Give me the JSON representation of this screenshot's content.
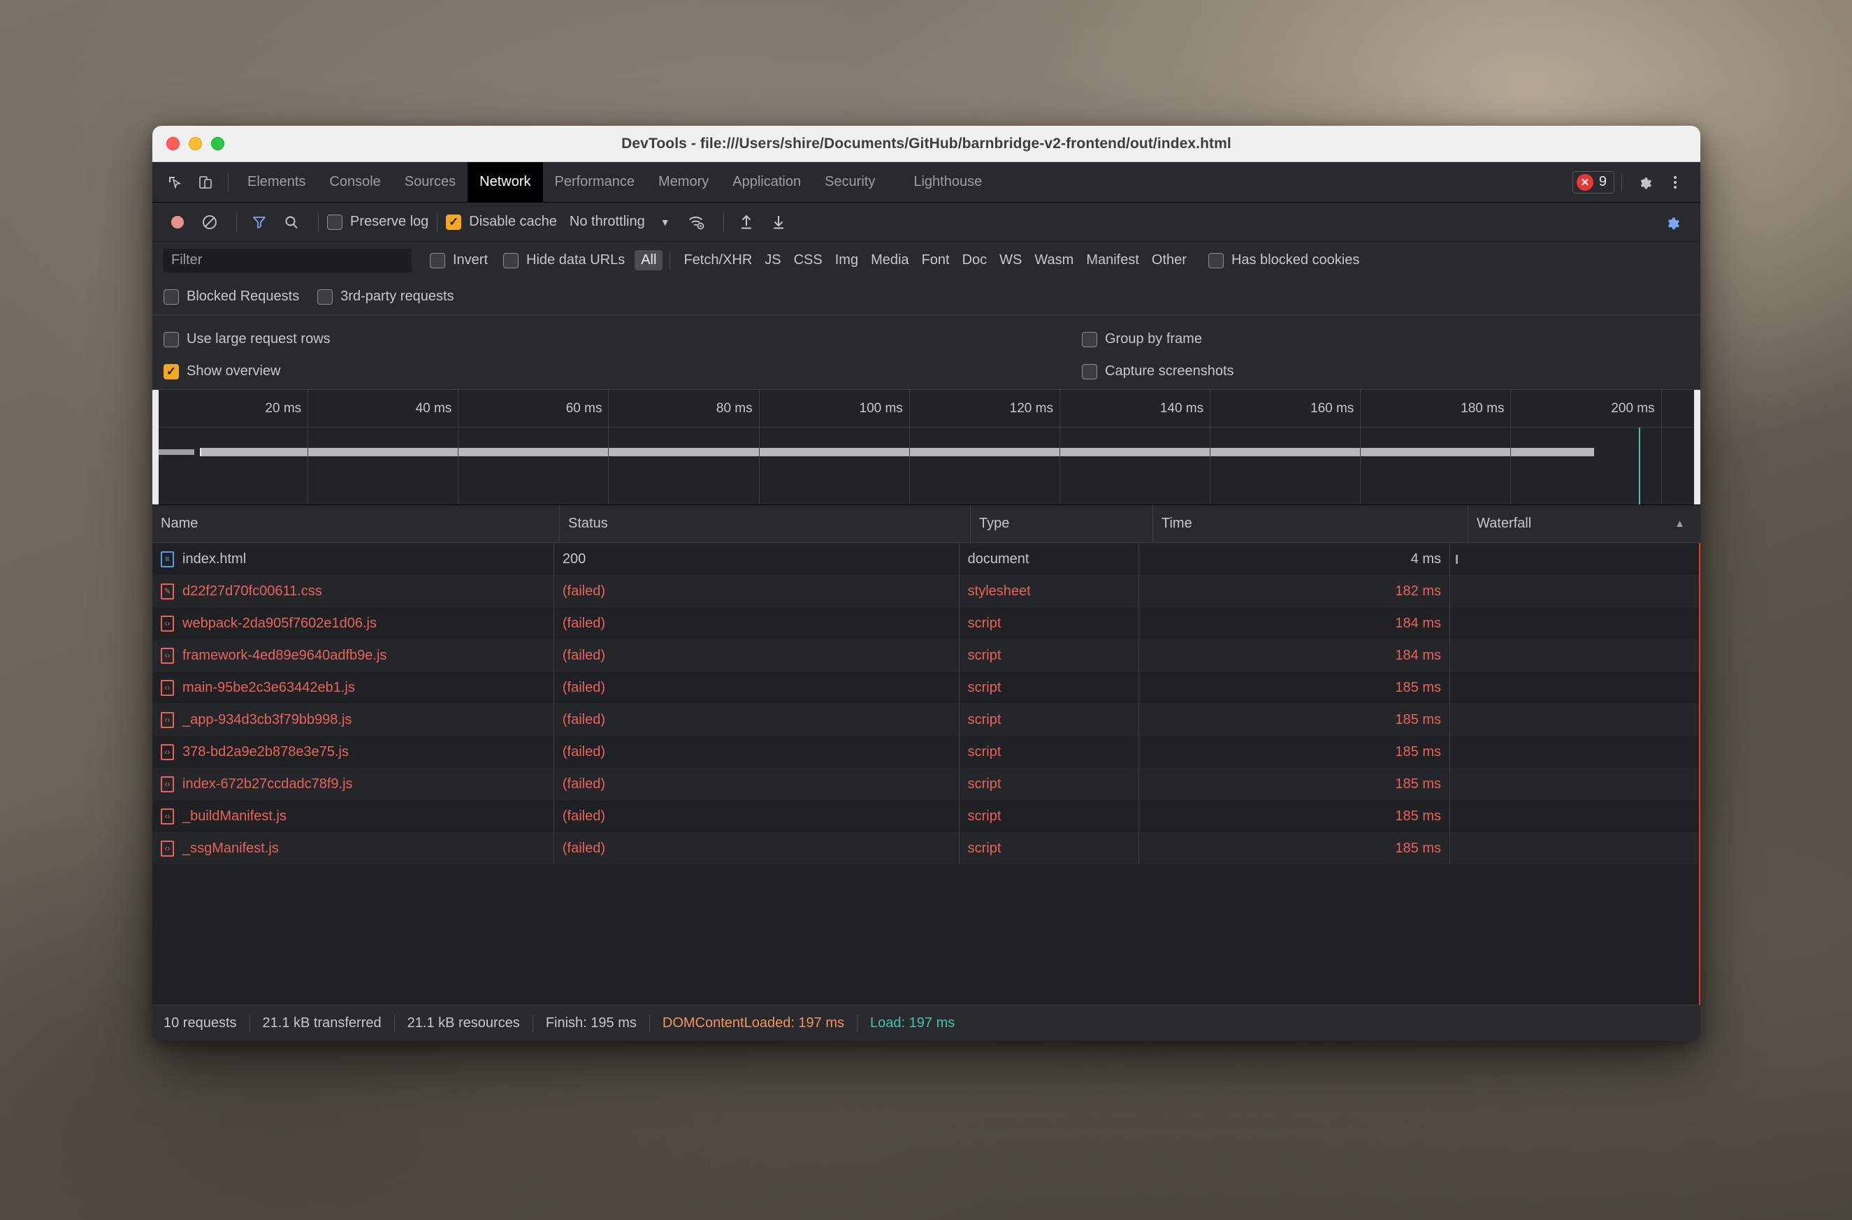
{
  "window": {
    "title": "DevTools - file:///Users/shire/Documents/GitHub/barnbridge-v2-frontend/out/index.html"
  },
  "tabbar": {
    "tabs": [
      {
        "label": "Elements",
        "active": false
      },
      {
        "label": "Console",
        "active": false
      },
      {
        "label": "Sources",
        "active": false
      },
      {
        "label": "Network",
        "active": true
      },
      {
        "label": "Performance",
        "active": false
      },
      {
        "label": "Memory",
        "active": false
      },
      {
        "label": "Application",
        "active": false
      },
      {
        "label": "Security",
        "active": false
      },
      {
        "label": "Lighthouse",
        "active": false
      }
    ],
    "error_count": "9",
    "icons": [
      "inspect-element-icon",
      "device-toolbar-icon",
      "error-icon",
      "settings-gear-icon",
      "more-options-icon"
    ]
  },
  "network_toolbar": {
    "record_label": "record-button",
    "clear_label": "clear-button",
    "filter_label": "filter-button",
    "search_label": "search-button",
    "preserve_log": {
      "label": "Preserve log",
      "checked": false
    },
    "disable_cache": {
      "label": "Disable cache",
      "checked": true
    },
    "throttling": {
      "value": "No throttling"
    },
    "import_label": "import-har-button",
    "export_label": "export-har-button",
    "network_conditions_label": "network-conditions-icon",
    "settings_label": "network-settings-icon"
  },
  "filterbar": {
    "filter_placeholder": "Filter",
    "filter_value": "",
    "invert": {
      "label": "Invert",
      "checked": false
    },
    "hide_data_urls": {
      "label": "Hide data URLs",
      "checked": false
    },
    "types": [
      {
        "label": "All",
        "active": true
      },
      {
        "label": "Fetch/XHR",
        "active": false
      },
      {
        "label": "JS",
        "active": false
      },
      {
        "label": "CSS",
        "active": false
      },
      {
        "label": "Img",
        "active": false
      },
      {
        "label": "Media",
        "active": false
      },
      {
        "label": "Font",
        "active": false
      },
      {
        "label": "Doc",
        "active": false
      },
      {
        "label": "WS",
        "active": false
      },
      {
        "label": "Wasm",
        "active": false
      },
      {
        "label": "Manifest",
        "active": false
      },
      {
        "label": "Other",
        "active": false
      }
    ],
    "has_blocked_cookies": {
      "label": "Has blocked cookies",
      "checked": false
    },
    "blocked_requests": {
      "label": "Blocked Requests",
      "checked": false
    },
    "third_party_requests": {
      "label": "3rd-party requests",
      "checked": false
    }
  },
  "settings": {
    "use_large_request_rows": {
      "label": "Use large request rows",
      "checked": false
    },
    "show_overview": {
      "label": "Show overview",
      "checked": true
    },
    "group_by_frame": {
      "label": "Group by frame",
      "checked": false
    },
    "capture_screenshots": {
      "label": "Capture screenshots",
      "checked": false
    }
  },
  "overview": {
    "ticks": [
      "20 ms",
      "40 ms",
      "60 ms",
      "80 ms",
      "100 ms",
      "120 ms",
      "140 ms",
      "160 ms",
      "180 ms",
      "200 ms"
    ],
    "load_marker_color": "#49c3b1",
    "load_marker_ms": 197
  },
  "table": {
    "columns": [
      "Name",
      "Status",
      "Type",
      "Time",
      "Waterfall"
    ],
    "sort_column": "Waterfall",
    "sort_direction": "ascending",
    "rows": [
      {
        "name": "index.html",
        "status": "200",
        "type": "document",
        "time": "4 ms",
        "failed": false,
        "icon": "document-icon"
      },
      {
        "name": "d22f27d70fc00611.css",
        "status": "(failed)",
        "type": "stylesheet",
        "time": "182 ms",
        "failed": true,
        "icon": "stylesheet-icon"
      },
      {
        "name": "webpack-2da905f7602e1d06.js",
        "status": "(failed)",
        "type": "script",
        "time": "184 ms",
        "failed": true,
        "icon": "script-icon"
      },
      {
        "name": "framework-4ed89e9640adfb9e.js",
        "status": "(failed)",
        "type": "script",
        "time": "184 ms",
        "failed": true,
        "icon": "script-icon"
      },
      {
        "name": "main-95be2c3e63442eb1.js",
        "status": "(failed)",
        "type": "script",
        "time": "185 ms",
        "failed": true,
        "icon": "script-icon"
      },
      {
        "name": "_app-934d3cb3f79bb998.js",
        "status": "(failed)",
        "type": "script",
        "time": "185 ms",
        "failed": true,
        "icon": "script-icon"
      },
      {
        "name": "378-bd2a9e2b878e3e75.js",
        "status": "(failed)",
        "type": "script",
        "time": "185 ms",
        "failed": true,
        "icon": "script-icon"
      },
      {
        "name": "index-672b27ccdadc78f9.js",
        "status": "(failed)",
        "type": "script",
        "time": "185 ms",
        "failed": true,
        "icon": "script-icon"
      },
      {
        "name": "_buildManifest.js",
        "status": "(failed)",
        "type": "script",
        "time": "185 ms",
        "failed": true,
        "icon": "script-icon"
      },
      {
        "name": "_ssgManifest.js",
        "status": "(failed)",
        "type": "script",
        "time": "185 ms",
        "failed": true,
        "icon": "script-icon"
      }
    ]
  },
  "statusbar": {
    "requests": "10 requests",
    "transferred": "21.1 kB transferred",
    "resources": "21.1 kB resources",
    "finish": "Finish: 195 ms",
    "dom_content_loaded": "DOMContentLoaded: 197 ms",
    "load": "Load: 197 ms"
  }
}
